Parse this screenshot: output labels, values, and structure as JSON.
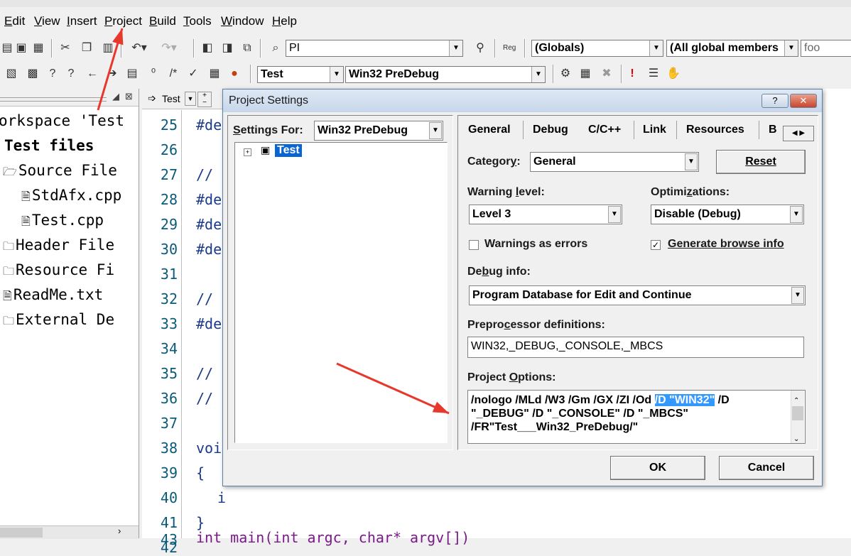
{
  "menubar": {
    "items": [
      "Edit",
      "View",
      "Insert",
      "Project",
      "Build",
      "Tools",
      "Window",
      "Help"
    ]
  },
  "toolbar": {
    "find_combo": "PI",
    "reg_label": "Reg",
    "globals_combo": "(Globals)",
    "members_combo": "(All global members",
    "function_combo": "foo",
    "project_combo": "Test",
    "config_combo": "Win32 PreDebug"
  },
  "workspace": {
    "title": "orkspace 'Test",
    "items": [
      "Test files",
      "Source File",
      "StdAfx.cpp",
      "Test.cpp",
      "Header File",
      "Resource Fi",
      "ReadMe.txt",
      "External De"
    ]
  },
  "editor": {
    "tab_label": "Test",
    "line_numbers": [
      "25",
      "26",
      "27",
      "28",
      "29",
      "30",
      "31",
      "32",
      "33",
      "34",
      "35",
      "36",
      "37",
      "38",
      "39",
      "40",
      "41",
      "42"
    ],
    "code_lines": [
      "#de",
      "",
      "//",
      "#de",
      "#de",
      "#de",
      "",
      "//",
      "#de",
      "",
      "//",
      "//",
      "",
      "voi",
      "{",
      "i",
      "}",
      ""
    ],
    "last_line_partial": "int main(int argc, char* argv[])"
  },
  "dialog": {
    "title": "Project Settings",
    "help_btn": "?",
    "close_btn": "✕",
    "settings_for_label": "Settings For:",
    "settings_for_value": "Win32 PreDebug",
    "tree_root": "Test",
    "tabs": [
      "General",
      "Debug",
      "C/C++",
      "Link",
      "Resources",
      "B"
    ],
    "category_label": "Category:",
    "category_value": "General",
    "reset_btn": "Reset",
    "warning_level_label": "Warning level:",
    "warning_level_value": "Level 3",
    "optimizations_label": "Optimizations:",
    "optimizations_value": "Disable (Debug)",
    "warnings_as_errors_label": "Warnings as errors",
    "warnings_as_errors_checked": false,
    "browse_info_label": "Generate browse info",
    "browse_info_checked": true,
    "debug_info_label": "Debug info:",
    "debug_info_value": "Program Database for Edit and Continue",
    "preproc_label": "Preprocessor definitions:",
    "preproc_value": "WIN32,_DEBUG,_CONSOLE,_MBCS",
    "project_options_label": "Project Options:",
    "project_options_pre": "/nologo /MLd /W3 /Gm /GX /ZI /Od ",
    "project_options_sel": "/D \"WIN32\"",
    "project_options_post": " /D",
    "project_options_line2": "\"_DEBUG\" /D \"_CONSOLE\" /D \"_MBCS\"",
    "project_options_line3": "/FR\"Test___Win32_PreDebug/\"",
    "ok_btn": "OK",
    "cancel_btn": "Cancel"
  },
  "annotation_color": "#e8372b"
}
